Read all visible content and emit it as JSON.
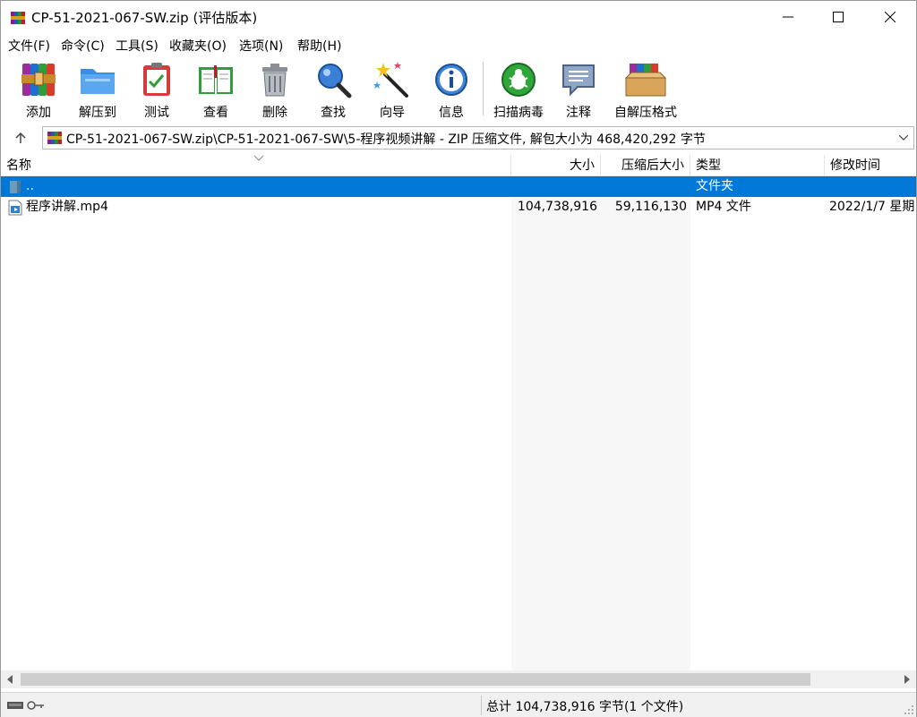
{
  "window": {
    "title": "CP-51-2021-067-SW.zip (评估版本)"
  },
  "menu": [
    {
      "label": "文件(F)"
    },
    {
      "label": "命令(C)"
    },
    {
      "label": "工具(S)"
    },
    {
      "label": "收藏夹(O)"
    },
    {
      "label": "选项(N)"
    },
    {
      "label": "帮助(H)"
    }
  ],
  "toolbar": [
    {
      "label": "添加",
      "icon": "add-archive-icon"
    },
    {
      "label": "解压到",
      "icon": "extract-to-folder-icon"
    },
    {
      "label": "测试",
      "icon": "test-clipboard-icon"
    },
    {
      "label": "查看",
      "icon": "view-book-icon"
    },
    {
      "label": "删除",
      "icon": "trash-icon"
    },
    {
      "label": "查找",
      "icon": "magnifier-icon"
    },
    {
      "label": "向导",
      "icon": "wizard-wand-icon"
    },
    {
      "label": "信息",
      "icon": "info-icon"
    },
    {
      "label": "扫描病毒",
      "icon": "virus-scan-icon"
    },
    {
      "label": "注释",
      "icon": "comment-bubble-icon"
    },
    {
      "label": "自解压格式",
      "icon": "sfx-box-icon"
    }
  ],
  "address": {
    "path": "CP-51-2021-067-SW.zip\\CP-51-2021-067-SW\\5-程序视频讲解 - ZIP 压缩文件, 解包大小为 468,420,292 字节"
  },
  "columns": {
    "name": "名称",
    "size": "大小",
    "packed": "压缩后大小",
    "type": "类型",
    "modified": "修改时间"
  },
  "rows": [
    {
      "name": "..",
      "size": "",
      "packed": "",
      "type": "文件夹",
      "modified": "",
      "selected": true,
      "icon": "parent-folder-icon"
    },
    {
      "name": "程序讲解.mp4",
      "size": "104,738,916",
      "packed": "59,116,130",
      "type": "MP4 文件",
      "modified": "2022/1/7 星期",
      "selected": false,
      "icon": "video-file-icon"
    }
  ],
  "status": {
    "summary": "总计 104,738,916 字节(1 个文件)"
  },
  "colors": {
    "selection": "#0078d7",
    "chrome": "#f0f0f0"
  }
}
